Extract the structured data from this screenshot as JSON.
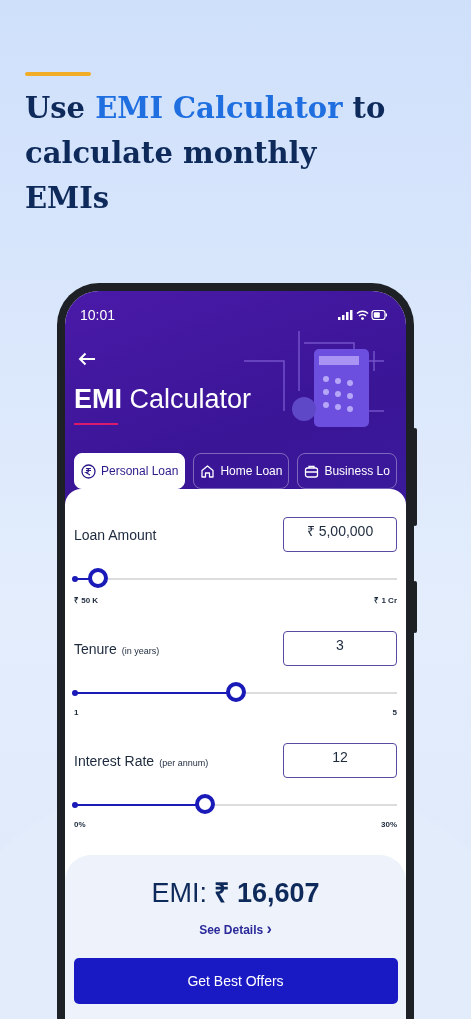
{
  "headline": {
    "before": "Use ",
    "highlight": "EMI Calculator",
    "after": " to calculate monthly EMIs"
  },
  "status_bar": {
    "time": "10:01"
  },
  "title": "**EMI** Calculator",
  "tabs": [
    {
      "label": "Personal Loan",
      "kind": "rupee",
      "selected": true
    },
    {
      "label": "Home Loan",
      "kind": "home",
      "selected": false
    },
    {
      "label": "Business Lo",
      "kind": "business",
      "selected": false
    }
  ],
  "fields": [
    {
      "label": "Loan Amount",
      "value": "₹ 5,00,000",
      "level": 0.074,
      "min": "₹ 50 K",
      "max": "₹ 1 Cr"
    },
    {
      "label": "Tenure",
      "hint": "(in years)",
      "value": "3",
      "level": 0.5,
      "min": "1",
      "max": "5"
    },
    {
      "label": "Interest Rate",
      "hint": "(per annum)",
      "value": "12",
      "level": 0.405,
      "min": "0%",
      "max": "30%"
    }
  ],
  "result": {
    "emi": "EMI: **₹ 16,607**",
    "details_link": "See Details",
    "chevron": "›",
    "button": "Get Best Offers"
  }
}
